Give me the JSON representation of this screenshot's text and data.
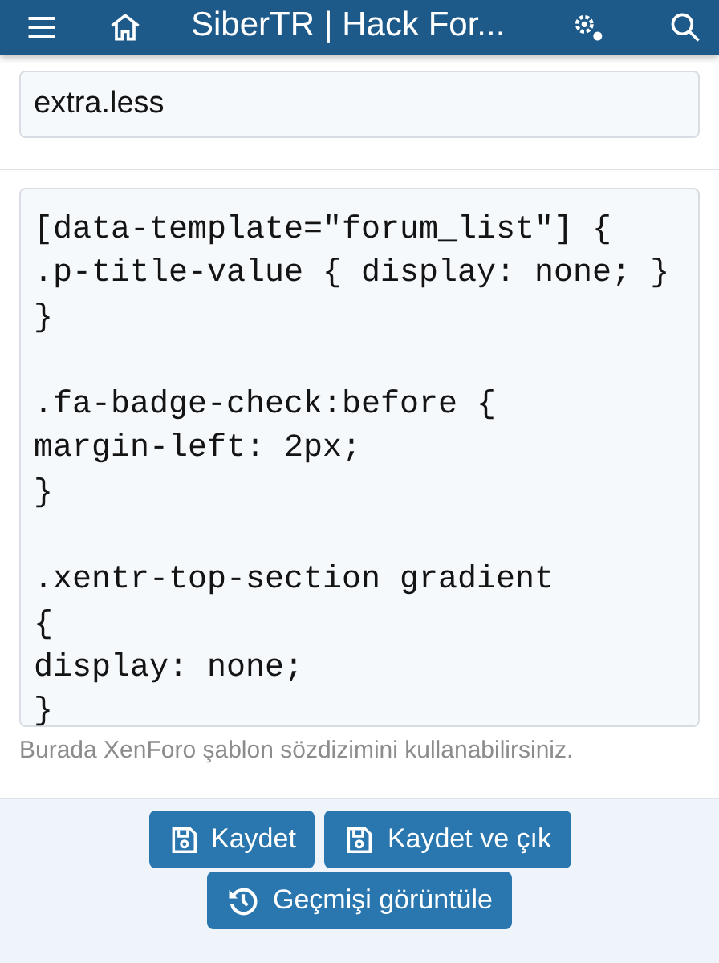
{
  "header": {
    "title": "SiberTR | Hack For..."
  },
  "filename": {
    "value": "extra.less"
  },
  "code": {
    "value": "[data-template=\"forum_list\"] {\n.p-title-value { display: none; }\n}\n\n.fa-badge-check:before {\nmargin-left: 2px;\n}\n\n.xentr-top-section gradient\n{\ndisplay: none;\n}"
  },
  "hint": "Burada XenForo şablon sözdizimini kullanabilirsiniz.",
  "buttons": [
    {
      "label": "Kaydet",
      "kind": "save"
    },
    {
      "label": "Kaydet ve çık",
      "kind": "save"
    },
    {
      "label": "Geçmişi görüntüle",
      "kind": "history"
    }
  ]
}
